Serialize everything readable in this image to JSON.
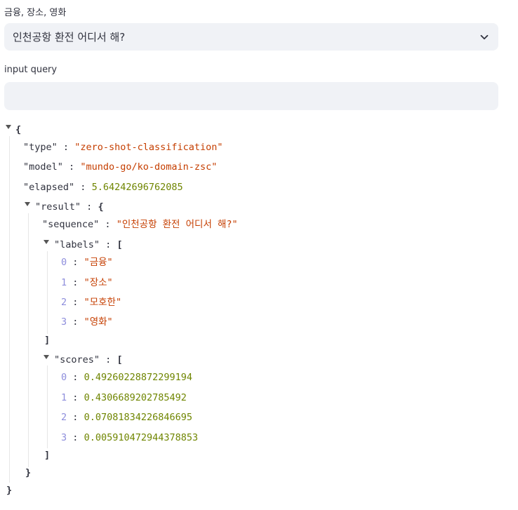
{
  "selectbox": {
    "label": "금융, 장소, 영화",
    "value": "인천공항 환전 어디서 해?",
    "icon": "chevron-down-icon"
  },
  "text_input": {
    "label": "input query",
    "value": "",
    "placeholder": ""
  },
  "json_output": {
    "open_brace": "{",
    "close_brace": "}",
    "open_bracket": "[",
    "close_bracket": "]",
    "colon": ":",
    "type_key": "\"type\"",
    "type_value": "\"zero-shot-classification\"",
    "model_key": "\"model\"",
    "model_value": "\"mundo-go/ko-domain-zsc\"",
    "elapsed_key": "\"elapsed\"",
    "elapsed_value": "5.64242696762085",
    "result_key": "\"result\"",
    "sequence_key": "\"sequence\"",
    "sequence_value": "\"인천공항 환전 어디서 해?\"",
    "labels_key": "\"labels\"",
    "labels": [
      {
        "index": "0",
        "value": "\"금융\""
      },
      {
        "index": "1",
        "value": "\"장소\""
      },
      {
        "index": "2",
        "value": "\"모호한\""
      },
      {
        "index": "3",
        "value": "\"영화\""
      }
    ],
    "scores_key": "\"scores\"",
    "scores": [
      {
        "index": "0",
        "value": "0.49260228872299194"
      },
      {
        "index": "1",
        "value": "0.4306689202785492"
      },
      {
        "index": "2",
        "value": "0.07081834226846695"
      },
      {
        "index": "3",
        "value": "0.005910472944378853"
      }
    ]
  }
}
